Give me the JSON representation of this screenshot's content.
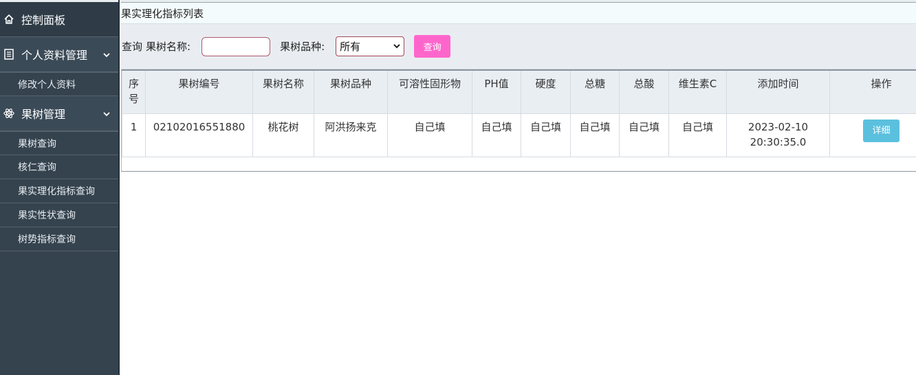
{
  "sidebar": {
    "dashboard": "控制面板",
    "profile_group": "个人资料管理",
    "profile_items": [
      "修改个人资料"
    ],
    "tree_group": "果树管理",
    "tree_items": [
      "果树查询",
      "核仁查询",
      "果实理化指标查询",
      "果实性状查询",
      "树势指标查询"
    ]
  },
  "main": {
    "title": "果实理化指标列表",
    "search": {
      "query_label": "查询",
      "name_label": "果树名称:",
      "name_value": "",
      "variety_label": "果树品种:",
      "variety_selected": "所有",
      "button": "查询"
    },
    "table": {
      "headers": [
        "序号",
        "果树编号",
        "果树名称",
        "果树品种",
        "可溶性固形物",
        "PH值",
        "硬度",
        "总糖",
        "总酸",
        "维生素C",
        "添加时间",
        "操作"
      ],
      "rows": [
        {
          "index": "1",
          "tree_no": "02102016551880",
          "tree_name": "桃花树",
          "variety": "阿洪扬来克",
          "soluble_solids": "自己填",
          "ph": "自己填",
          "hardness": "自己填",
          "total_sugar": "自己填",
          "total_acid": "自己填",
          "vitamin_c": "自己填",
          "added_time": "2023-02-10 20:30:35.0",
          "action": "详细"
        }
      ]
    }
  },
  "colors": {
    "sidebar_bg": "#35434f",
    "search_button": "#ff66cc",
    "detail_button": "#5bc0de"
  }
}
